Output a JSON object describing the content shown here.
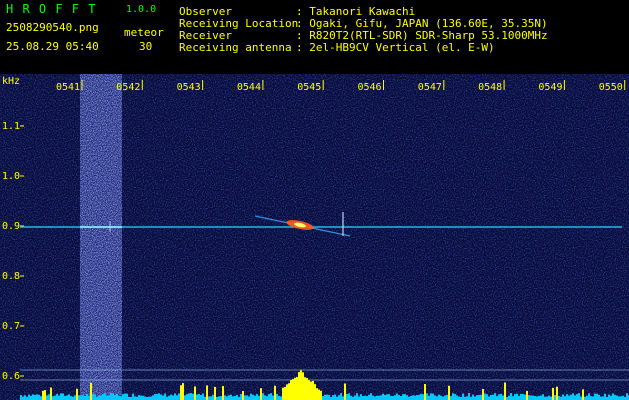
{
  "app": {
    "name": "H R O F F T",
    "version": "1.0.0",
    "filename": "2508290540.png",
    "datetime": "25.08.29 05:40",
    "meteor_label": "meteor",
    "meteor_count": "30"
  },
  "info": {
    "observer_label": "Observer",
    "observer_value": ": Takanori Kawachi",
    "location_label": "Receiving Location",
    "location_value": ": Ogaki, Gifu, JAPAN (136.60E, 35.35N)",
    "receiver_label": "Receiver",
    "receiver_value": ": R820T2(RTL-SDR) SDR-Sharp 53.1000MHz",
    "antenna_label": "Receiving antenna",
    "antenna_value": ": 2el-HB9CV Vertical (el. E-W)"
  },
  "axis": {
    "y_unit": "kHz",
    "y_ticks": [
      "1.1",
      "1.0",
      "0.9",
      "0.8",
      "0.7",
      "0.6"
    ],
    "x_ticks": [
      "0541",
      "0542",
      "0543",
      "0544",
      "0545",
      "0546",
      "0547",
      "0548",
      "0549",
      "0550"
    ]
  },
  "colors": {
    "background": "#0a0a3a",
    "text_green": "#00ff00",
    "text_yellow": "#ffff00",
    "carrier": "#2ad0ff",
    "spectrum_base": "#00c8ff",
    "spectrum_peak": "#ffff00"
  }
}
